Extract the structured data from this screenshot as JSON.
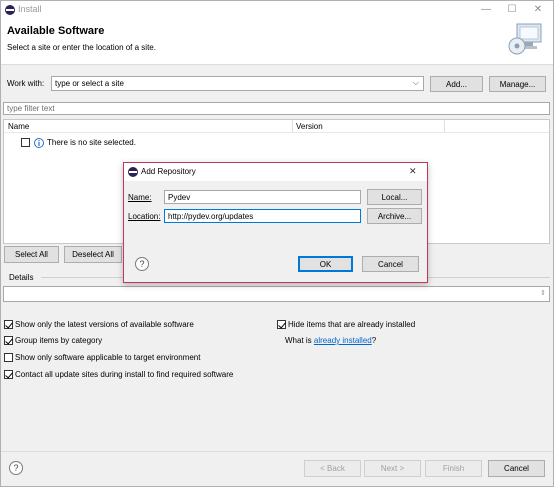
{
  "window": {
    "title": "Install",
    "controls": [
      "—",
      "☐",
      "✕"
    ]
  },
  "header": {
    "title": "Available Software",
    "subtitle": "Select a site or enter the location of a site."
  },
  "workwith": {
    "label": "Work with:",
    "value": "type or select a site",
    "add_label": "Add...",
    "manage_label": "Manage..."
  },
  "filter": {
    "placeholder": "type filter text"
  },
  "table": {
    "col_name": "Name",
    "col_version": "Version",
    "empty_message": "There is no site selected."
  },
  "selection": {
    "select_all": "Select All",
    "deselect_all": "Deselect All"
  },
  "details": {
    "label": "Details"
  },
  "options": {
    "latest": "Show only the latest versions of available software",
    "hide_installed": "Hide items that are already installed",
    "group": "Group items by category",
    "what_is": "What is ",
    "already_installed": "already installed",
    "what_is_end": "?",
    "applicable": "Show only software applicable to target environment",
    "contact": "Contact all update sites during install to find required software"
  },
  "footer": {
    "back": "< Back",
    "next": "Next >",
    "finish": "Finish",
    "cancel": "Cancel",
    "help": "?"
  },
  "dialog": {
    "title": "Add Repository",
    "close": "✕",
    "name_label": "Name:",
    "name_value": "Pydev",
    "location_label": "Location:",
    "location_value": "http://pydev.org/updates",
    "local_label": "Local...",
    "archive_label": "Archive...",
    "ok_label": "OK",
    "cancel_label": "Cancel",
    "help": "?"
  },
  "colors": {
    "accent": "#0078d7",
    "dialog_border": "#c0395a",
    "link": "#0066cc"
  }
}
